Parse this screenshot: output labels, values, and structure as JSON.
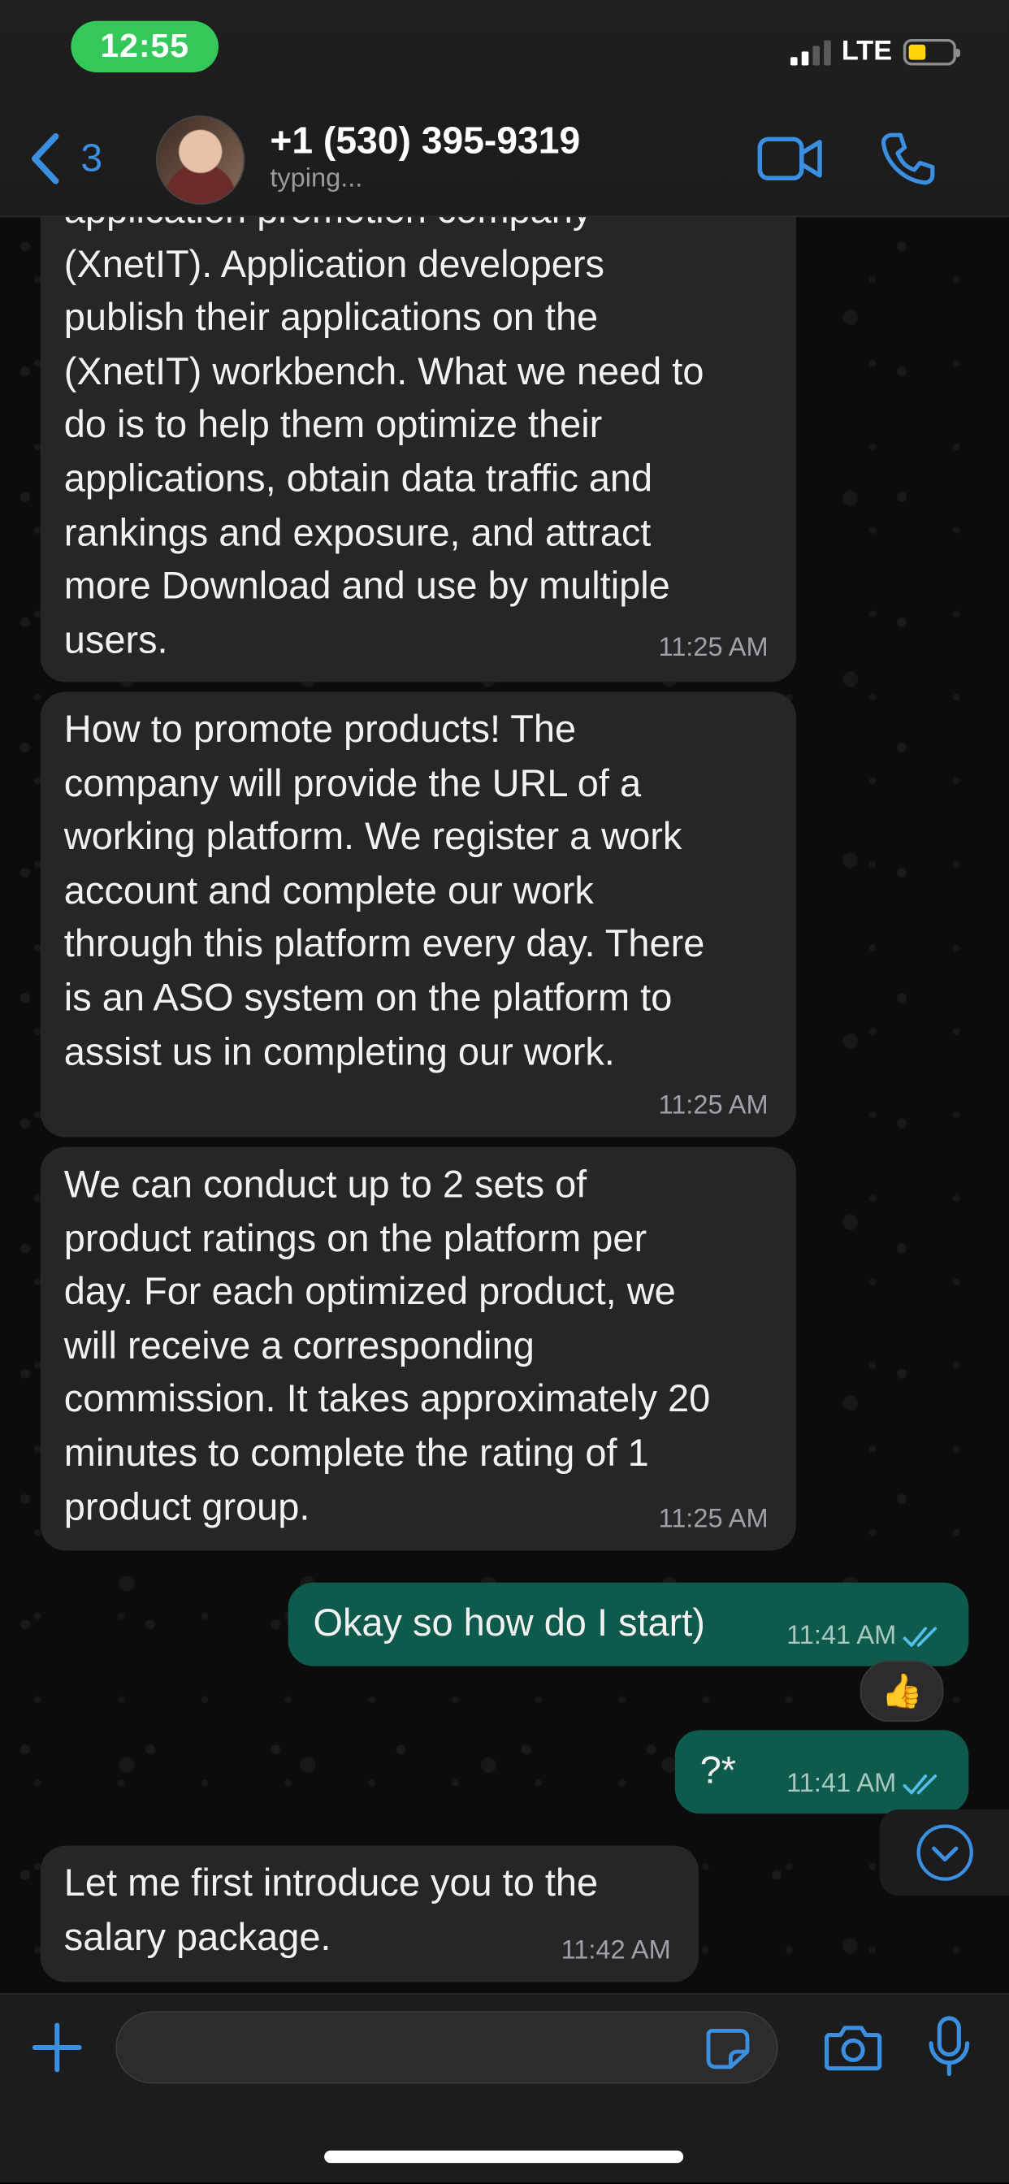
{
  "status_bar": {
    "time": "12:55",
    "network": "LTE"
  },
  "header": {
    "back_count": "3",
    "contact_name": "+1 (530) 395-9319",
    "contact_status": "typing..."
  },
  "icons": {
    "back": "chevron-left-icon",
    "video": "video-camera-icon",
    "call": "phone-icon",
    "plus": "plus-icon",
    "sticker": "sticker-icon",
    "camera": "camera-icon",
    "mic": "microphone-icon",
    "scroll": "chevron-down-icon"
  },
  "colors": {
    "accent": "#3a8fe0",
    "incoming_bubble": "#262628",
    "outgoing_bubble": "#0e5a4c",
    "read_ticks": "#53bdeb"
  },
  "messages": [
    {
      "direction": "incoming",
      "text": "application promotion company\n(XnetIT). Application developers\npublish their applications on the\n(XnetIT) workbench. What we need to\ndo is to help them optimize their\napplications, obtain data traffic and\nrankings and exposure, and attract\nmore Download and use by multiple\nusers.",
      "time": "11:25 AM"
    },
    {
      "direction": "incoming",
      "text": "How to promote products! The\ncompany will provide the URL of a\nworking platform. We register a work\naccount and complete our work\nthrough this platform every day. There\nis an ASO system on the platform to\nassist us in completing our work.",
      "time": "11:25 AM"
    },
    {
      "direction": "incoming",
      "text": "We can conduct up to 2 sets of\nproduct ratings on the platform per\nday. For each optimized product, we\nwill receive a corresponding\ncommission. It takes approximately 20\nminutes to complete the rating of 1\nproduct group.",
      "time": "11:25 AM"
    },
    {
      "direction": "outgoing",
      "text": "Okay so how do I start)",
      "time": "11:41 AM",
      "reaction": "👍"
    },
    {
      "direction": "outgoing",
      "text": "?*",
      "time": "11:41 AM"
    },
    {
      "direction": "incoming",
      "text": "Let me first introduce you to the\nsalary package.",
      "time": "11:42 AM"
    }
  ],
  "composer": {
    "value": "",
    "placeholder": ""
  }
}
